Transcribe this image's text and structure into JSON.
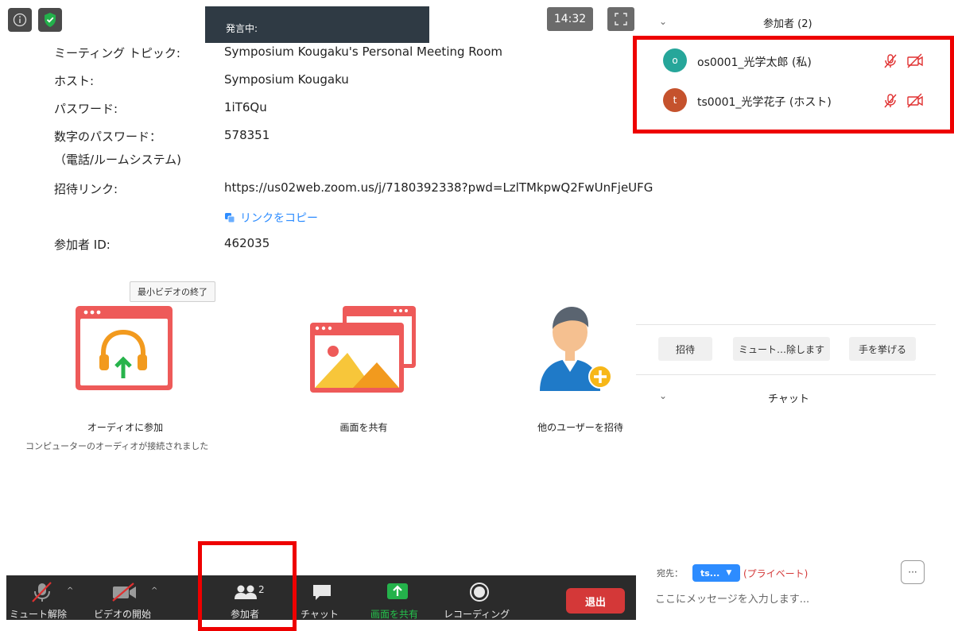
{
  "meeting_info": {
    "topic_label": "ミーティング トピック:",
    "topic_value": "Symposium Kougaku's Personal Meeting Room",
    "host_label": "ホスト:",
    "host_value": "Symposium Kougaku",
    "password_label": "パスワード:",
    "password_value": "1iT6Qu",
    "numeric_password_label": "数字のパスワード：",
    "numeric_password_sub": "（電話/ルームシステム)",
    "numeric_password_value": "578351",
    "invite_link_label": "招待リンク:",
    "invite_link_value": "https://us02web.zoom.us/j/7180392338?pwd=LzlTMkpwQ2FwUnFjeUFG",
    "copy_link": "リンクをコピー",
    "participant_id_label": "参加者 ID:",
    "participant_id_value": "462035"
  },
  "top_bar": {
    "speaking": "発言中:",
    "time": "14:32"
  },
  "tooltip": "最小ビデオの終了",
  "actions": {
    "audio_label": "オーディオに参加",
    "audio_sub": "コンピューターのオーディオが接続されました",
    "share_label": "画面を共有",
    "invite_label": "他のユーザーを招待"
  },
  "toolbar": {
    "mute": "ミュート解除",
    "video": "ビデオの開始",
    "participants": "参加者",
    "participants_count": "2",
    "chat": "チャット",
    "share": "画面を共有",
    "record": "レコーディング",
    "leave": "退出"
  },
  "participants_panel": {
    "title": "参加者 (2)",
    "participants": [
      {
        "initial": "o",
        "name": "os0001_光学太郎 (私)",
        "color": "#26a69a"
      },
      {
        "initial": "t",
        "name": "ts0001_光学花子 (ホスト)",
        "color": "#c5522d"
      }
    ],
    "invite_btn": "招待",
    "mute_all_btn": "ミュート…除します",
    "raise_hand_btn": "手を挙げる"
  },
  "chat_panel": {
    "title": "チャット",
    "to_label": "宛先：",
    "to_value": "ts...",
    "private": "(プライベート)",
    "more": "···",
    "placeholder": "ここにメッセージを入力します..."
  },
  "colors": {
    "accent_blue": "#2d8cff",
    "danger_red": "#d43838",
    "share_green": "#24b24b",
    "highlight_red": "#ee0000"
  }
}
